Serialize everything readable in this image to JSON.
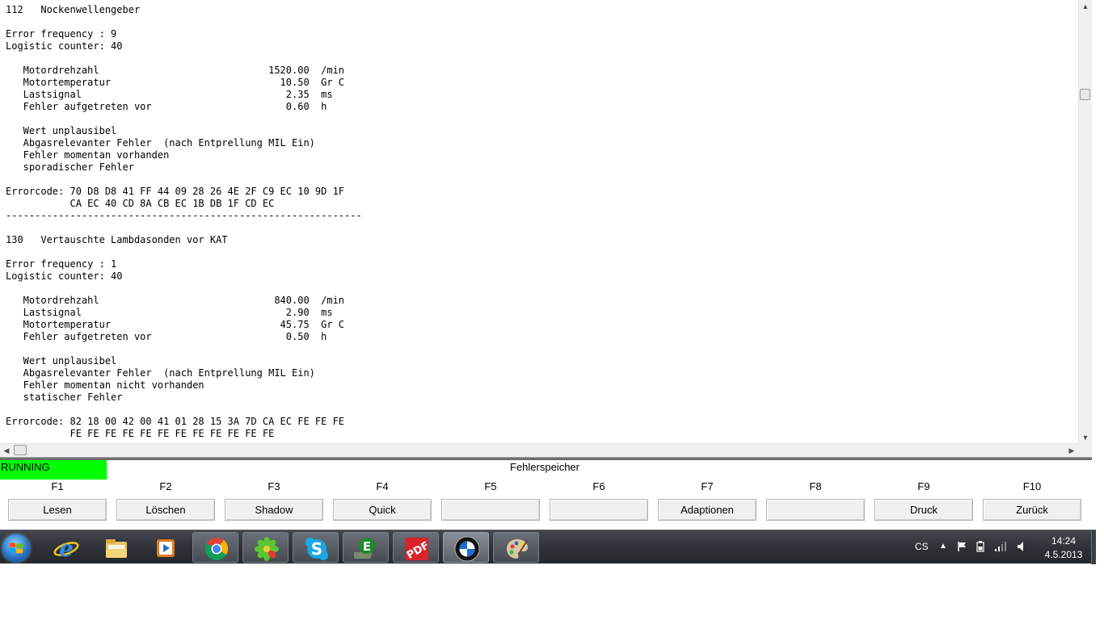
{
  "report": {
    "lines": [
      "112   Nockenwellengeber",
      "",
      "Error frequency : 9",
      "Logistic counter: 40",
      "",
      "   Motordrehzahl                             1520.00  /min",
      "   Motortemperatur                             10.50  Gr C",
      "   Lastsignal                                   2.35  ms",
      "   Fehler aufgetreten vor                       0.60  h",
      "",
      "   Wert unplausibel",
      "   Abgasrelevanter Fehler  (nach Entprellung MIL Ein)",
      "   Fehler momentan vorhanden",
      "   sporadischer Fehler",
      "",
      "Errorcode: 70 D8 D8 41 FF 44 09 28 26 4E 2F C9 EC 10 9D 1F",
      "           CA EC 40 CD 8A CB EC 1B DB 1F CD EC",
      "-------------------------------------------------------------",
      "",
      "130   Vertauschte Lambdasonden vor KAT",
      "",
      "Error frequency : 1",
      "Logistic counter: 40",
      "",
      "   Motordrehzahl                              840.00  /min",
      "   Lastsignal                                   2.90  ms",
      "   Motortemperatur                             45.75  Gr C",
      "   Fehler aufgetreten vor                       0.50  h",
      "",
      "   Wert unplausibel",
      "   Abgasrelevanter Fehler  (nach Entprellung MIL Ein)",
      "   Fehler momentan nicht vorhanden",
      "   statischer Fehler",
      "",
      "Errorcode: 82 18 00 42 00 41 01 28 15 3A 7D CA EC FE FE FE",
      "           FE FE FE FE FE FE FE FE FE FE FE FE"
    ]
  },
  "status": {
    "label": "RUNNING",
    "color": "#00ff00"
  },
  "screen_title": "Fehlerspeicher",
  "function_keys": [
    {
      "key": "F1",
      "label": "Lesen"
    },
    {
      "key": "F2",
      "label": "Löschen"
    },
    {
      "key": "F3",
      "label": "Shadow"
    },
    {
      "key": "F4",
      "label": "Quick"
    },
    {
      "key": "F5",
      "label": ""
    },
    {
      "key": "F6",
      "label": ""
    },
    {
      "key": "F7",
      "label": "Adaptionen"
    },
    {
      "key": "F8",
      "label": ""
    },
    {
      "key": "F9",
      "label": "Druck"
    },
    {
      "key": "F10",
      "label": "Zurück"
    }
  ],
  "taskbar": {
    "apps": [
      {
        "icon": "internet-explorer-icon",
        "state": "pinned"
      },
      {
        "icon": "file-explorer-icon",
        "state": "pinned"
      },
      {
        "icon": "media-player-icon",
        "state": "pinned"
      },
      {
        "icon": "chrome-icon",
        "state": "open"
      },
      {
        "icon": "icq-flower-icon",
        "state": "open"
      },
      {
        "icon": "skype-icon",
        "state": "open"
      },
      {
        "icon": "ediabas-e-icon",
        "state": "open"
      },
      {
        "icon": "pdf-icon",
        "state": "open"
      },
      {
        "icon": "bmw-logo-icon",
        "state": "active"
      },
      {
        "icon": "paint-palette-icon",
        "state": "open"
      }
    ],
    "tray": {
      "language": "CS",
      "time": "14:24",
      "date": "4.5.2013"
    }
  }
}
